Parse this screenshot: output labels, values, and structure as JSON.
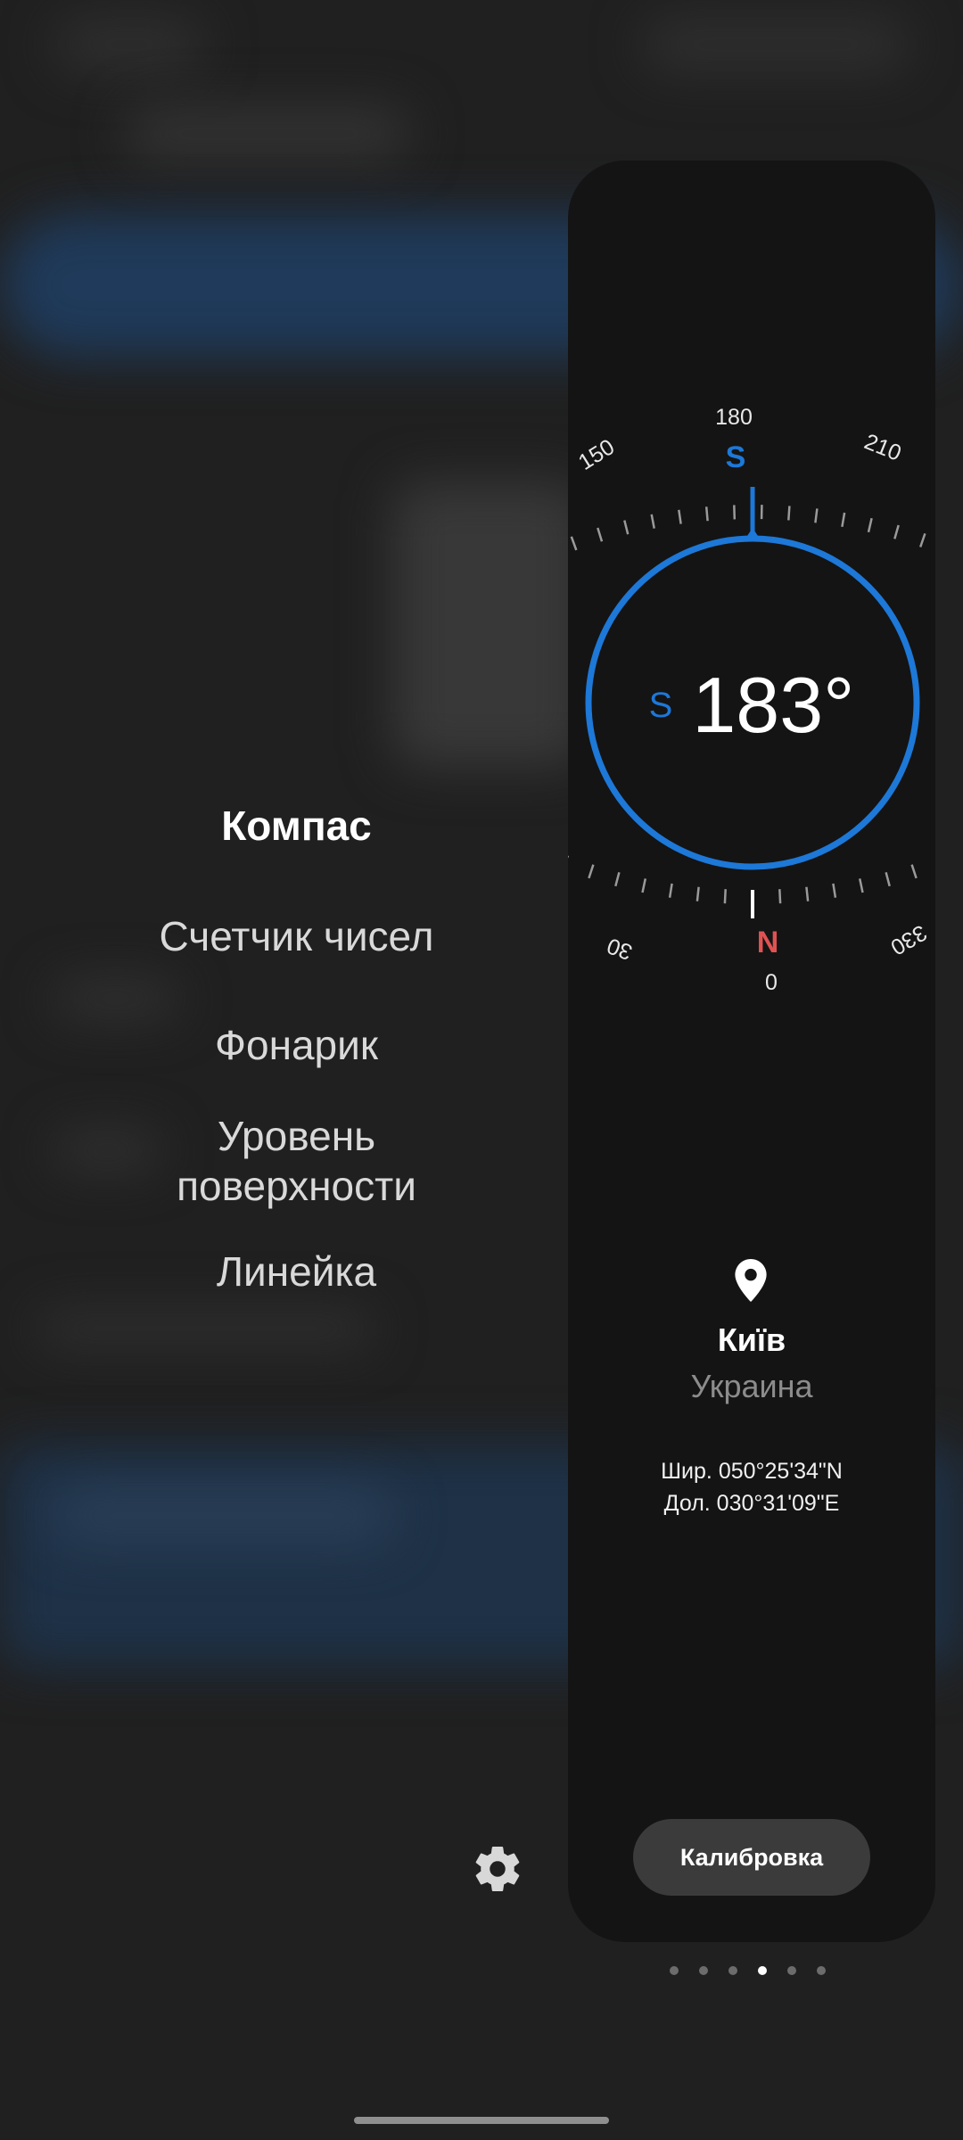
{
  "menu": {
    "items": [
      {
        "label": "Компас",
        "active": true
      },
      {
        "label": "Счетчик чисел",
        "active": false
      },
      {
        "label": "Фонарик",
        "active": false
      },
      {
        "label": "Уровень\nповерхности",
        "active": false
      },
      {
        "label": "Линейка",
        "active": false
      }
    ],
    "settings_icon": "gear-icon"
  },
  "compass": {
    "top_dial": {
      "labels": [
        "150",
        "180",
        "210"
      ],
      "cardinal": "S"
    },
    "bottom_dial": {
      "labels": [
        "30",
        "0",
        "330"
      ],
      "cardinal": "N"
    },
    "heading": {
      "direction": "S",
      "degrees": "183°"
    },
    "location": {
      "icon": "location-pin-icon",
      "city": "Київ",
      "country": "Украина",
      "latitude": "Шир. 050°25'34\"N",
      "longitude": "Дол. 030°31'09\"E"
    },
    "calibrate_label": "Калибровка"
  },
  "pager": {
    "count": 6,
    "active_index": 3
  },
  "colors": {
    "accent": "#1d78d8",
    "north": "#e05252",
    "panel": "#141414"
  }
}
